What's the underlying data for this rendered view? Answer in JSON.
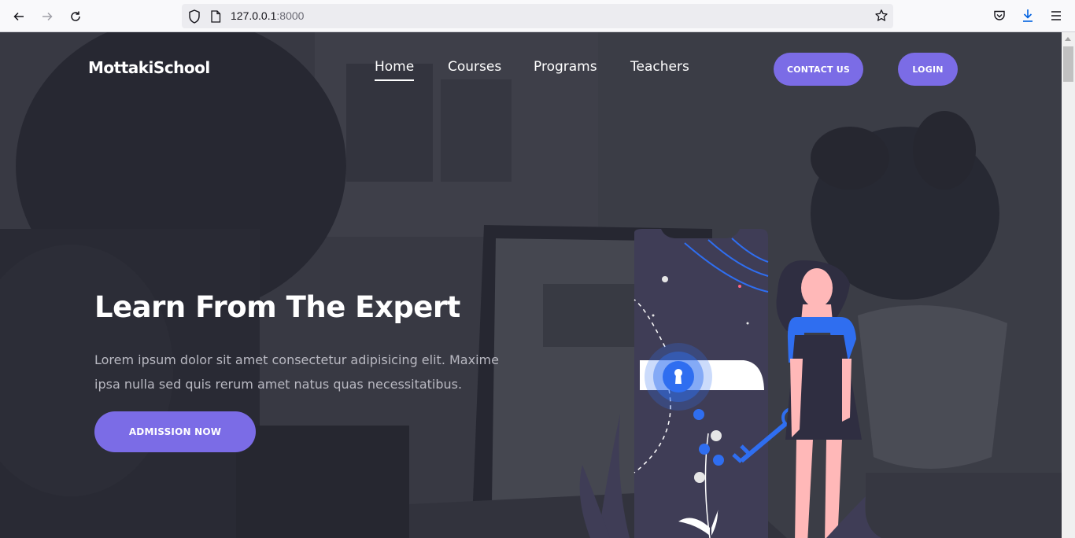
{
  "browser": {
    "url_host": "127.0.0.1",
    "url_port": ":8000",
    "icons": [
      "back-icon",
      "forward-icon",
      "reload-icon",
      "shield-icon",
      "page-icon",
      "star-icon",
      "pocket-icon",
      "download-icon",
      "menu-icon"
    ]
  },
  "site": {
    "logo": "MottakiSchool",
    "nav": [
      {
        "label": "Home",
        "active": true
      },
      {
        "label": "Courses",
        "active": false
      },
      {
        "label": "Programs",
        "active": false
      },
      {
        "label": "Teachers",
        "active": false
      }
    ],
    "contact_label": "Contact Us",
    "login_label": "Login"
  },
  "hero": {
    "title": "Learn From The Expert",
    "text": "Lorem ipsum dolor sit amet consectetur adipisicing elit. Maxime ipsa nulla sed quis rerum amet natus quas necessitatibus.",
    "button_label": "Admission Now"
  },
  "colors": {
    "accent": "#7b6ce6",
    "overlay": "#3c3d46",
    "illustration_blue": "#2f6ef0",
    "phone_bg": "#3f3d56"
  }
}
